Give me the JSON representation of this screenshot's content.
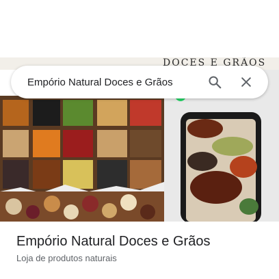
{
  "search": {
    "query": "Empório Natural Doces e Grãos",
    "search_icon": "search-icon",
    "close_icon": "close-icon"
  },
  "hero": {
    "banner_text": "DOCES E GRÃOS"
  },
  "place": {
    "name": "Empório Natural Doces e Grãos",
    "category": "Loja de produtos naturais"
  },
  "colors": {
    "text_primary": "#202124",
    "text_secondary": "#5f6368",
    "icon": "#5f6368",
    "whatsapp_green": "#25d366"
  }
}
